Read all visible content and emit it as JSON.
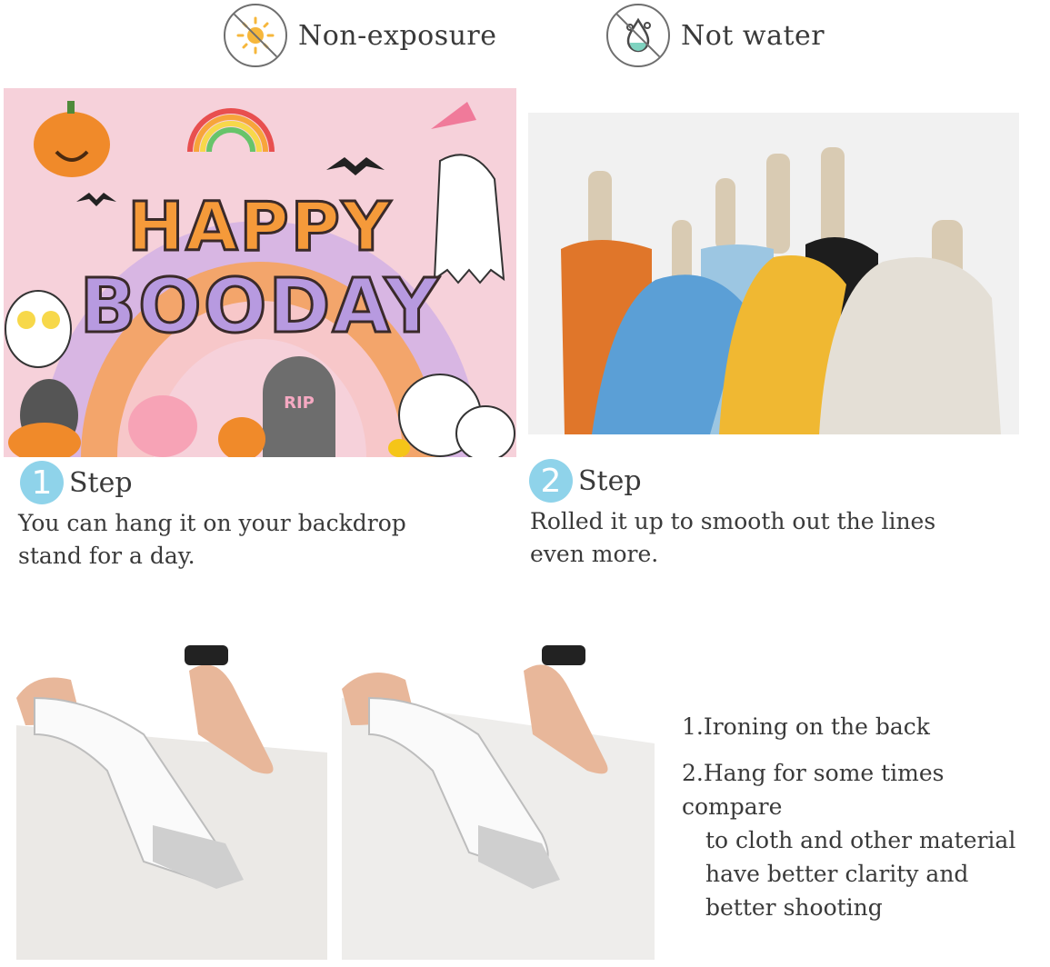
{
  "badges": [
    {
      "label": "Non-exposure",
      "icon": "sun-icon"
    },
    {
      "label": "Not water",
      "icon": "water-drop-icon"
    }
  ],
  "banner": {
    "line1": "HAPPY",
    "line2": "BOODAY",
    "tombstone": "RIP"
  },
  "steps": [
    {
      "number": "1",
      "title": "Step",
      "line1": "You can hang it on your backdrop",
      "line2": "stand for a day."
    },
    {
      "number": "2",
      "title": "Step",
      "line1": "Rolled it up to smooth out the lines",
      "line2": "even more."
    }
  ],
  "notes": {
    "item1": "1.Ironing on the back",
    "item2_line1": "2.Hang for some times compare",
    "item2_line2": "to cloth and other material",
    "item2_line3": "have better clarity and",
    "item2_line4": "better shooting"
  },
  "colors": {
    "step_circle": "#8fd3ea",
    "banner_bg": "#f6d1da",
    "text": "#3a3a3a"
  }
}
